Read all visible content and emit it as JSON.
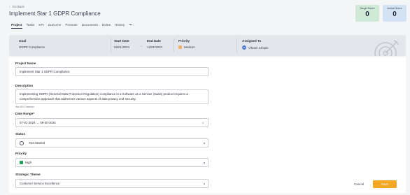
{
  "header": {
    "go_back": "Go Back",
    "title": "Implement Star 1 GDPR Compliance",
    "tabs": [
      {
        "label": "Project",
        "active": true
      },
      {
        "label": "Tasks"
      },
      {
        "label": "KPI"
      },
      {
        "label": "Outcome"
      },
      {
        "label": "Promote"
      },
      {
        "label": "Documents"
      },
      {
        "label": "Notes"
      },
      {
        "label": "History"
      },
      {
        "label": "•••"
      }
    ]
  },
  "scores": {
    "target_label": "Target Score",
    "target_value": "0",
    "actual_label": "Actual Score",
    "actual_value": "0"
  },
  "summary": {
    "goal_label": "Goal",
    "goal_value": "GDPR Compliance",
    "start_label": "Start Date",
    "start_value": "06/01/2024",
    "arrow": "→",
    "end_label": "End Date",
    "end_value": "12/01/2024",
    "priority_label": "Priority",
    "priority_value": "Medium",
    "assigned_label": "Assigned To",
    "assigned_initials": "VC",
    "assigned_value": "Vikram Crispin"
  },
  "form": {
    "project_name_label": "Project Name",
    "project_name_value": "Implement Star 1 GDPR Compliance",
    "description_label": "Description",
    "description_value": "Implementing GDPR (General Data Protection Regulation) compliance in a Software as a Service (SaaS) product requires a comprehensive approach that addresses various aspects of data privacy and security.",
    "description_hint": "Has 400 Character",
    "date_range_label": "Date Range*",
    "date_range_value": "07-01-2024 → 09-30-2024",
    "status_label": "Status",
    "status_value": "Not Started",
    "priority_label": "Priority",
    "priority_value": "High",
    "theme_label": "Strategic Theme",
    "theme_value": "Customer Service Excellence"
  },
  "actions": {
    "cancel": "Cancel",
    "save": "Save"
  },
  "colors": {
    "save": "#f5a623",
    "target_bg": "#cfe9d7",
    "actual_bg": "#d3e3f5",
    "priority_high": "#22a05a",
    "priority_medium": "#f6b26b"
  }
}
